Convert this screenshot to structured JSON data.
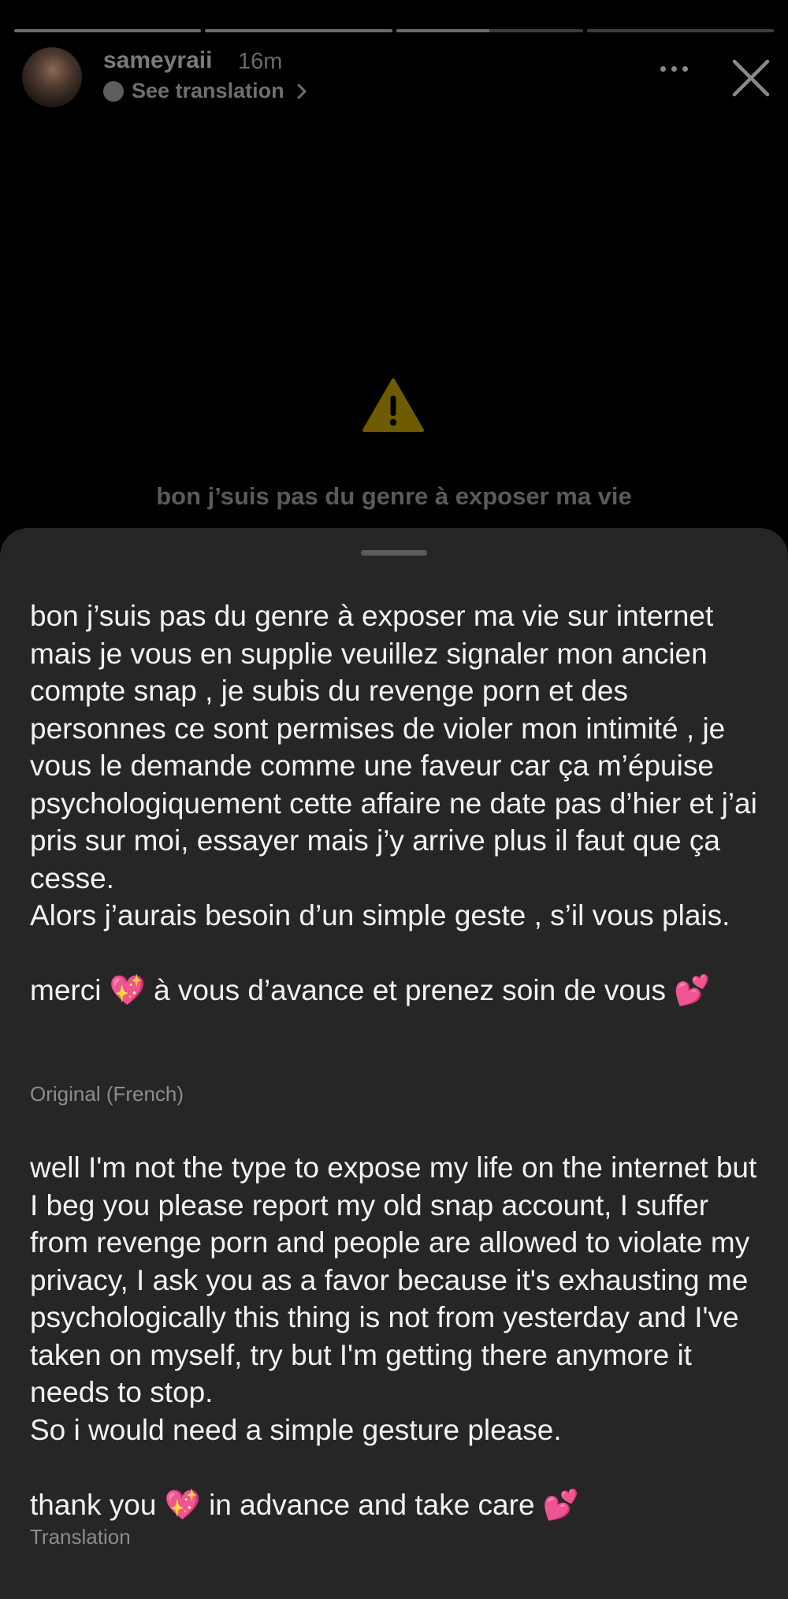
{
  "story": {
    "progress": [
      1.0,
      1.0,
      0.5,
      0.0
    ],
    "username": "sameyraii",
    "time_ago": "16m",
    "see_translation": "See translation",
    "caption_preview": "bon j’suis pas du genre à exposer ma vie",
    "icons": {
      "globe": "globe-icon",
      "chevron": "chevron-right-icon",
      "more": "more-icon",
      "close": "close-icon",
      "warning": "warning-icon"
    }
  },
  "sheet": {
    "original_text": "bon j’suis pas du genre à exposer ma vie sur internet mais je vous en supplie veuillez signaler mon ancien compte snap , je subis du revenge porn et des personnes ce sont permises de violer mon intimité , je vous le demande comme une faveur car ça m’épuise psychologiquement cette affaire ne date pas d’hier et j’ai pris sur moi, essayer mais j’y arrive plus il faut que ça cesse.\nAlors j’aurais besoin d’un simple geste , s’il vous plais.\n\nmerci 💖 à vous d’avance et prenez soin de vous 💕",
    "original_label": "Original (French)",
    "translated_text": "well I'm not the type to expose my life on the internet but I beg you please report my old snap account, I suffer from revenge porn and people are allowed to violate my privacy, I ask you as a favor because it's exhausting me psychologically this thing is not from yesterday and I've taken on myself, try but I'm getting there anymore it needs to stop.\nSo i would need a simple gesture please.\n\nthank you 💖 in advance and take care 💕",
    "translation_label": "Translation"
  },
  "colors": {
    "background": "#000000",
    "sheet": "#262626",
    "text": "#f2f2f2",
    "muted": "#8c8c8c",
    "warning": "#d8b400"
  }
}
